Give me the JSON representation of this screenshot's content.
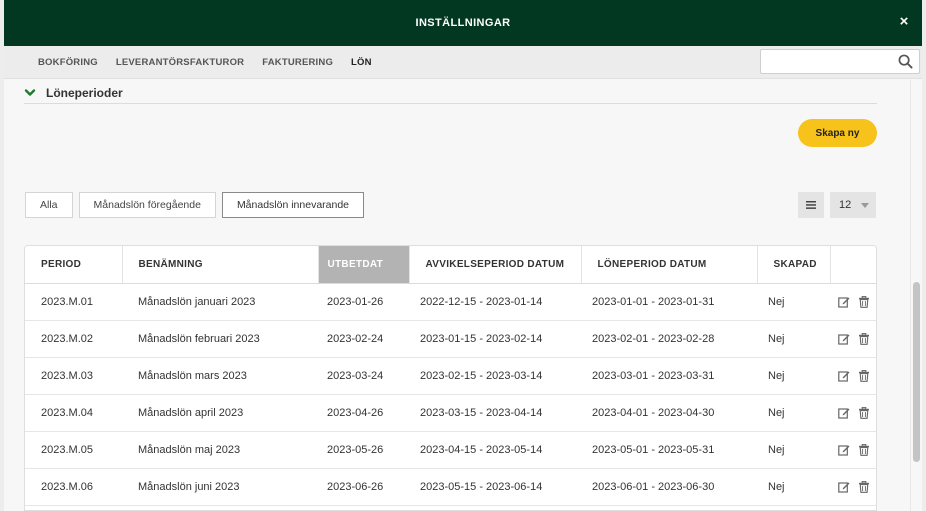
{
  "modal": {
    "title": "INSTÄLLNINGAR",
    "close_label": "×"
  },
  "tabs": [
    {
      "label": "BOKFÖRING"
    },
    {
      "label": "LEVERANTÖRSFAKTUROR"
    },
    {
      "label": "FAKTURERING"
    },
    {
      "label": "LÖN",
      "active": true
    }
  ],
  "search": {
    "value": "",
    "placeholder": ""
  },
  "section": {
    "title": "Löneperioder"
  },
  "create_button": {
    "label": "Skapa ny"
  },
  "filters": [
    {
      "label": "Alla"
    },
    {
      "label": "Månadslön föregående"
    },
    {
      "label": "Månadslön innevarande",
      "active": true
    }
  ],
  "per_page": {
    "value": "12"
  },
  "table": {
    "columns": [
      "PERIOD",
      "BENÄMNING",
      "UTBETDAT",
      "AVVIKELSEPERIOD DATUM",
      "LÖNEPERIOD DATUM",
      "SKAPAD",
      ""
    ],
    "sorted_column": "UTBETDAT",
    "rows": [
      {
        "period": "2023.M.01",
        "name": "Månadslön januari 2023",
        "paid": "2023-01-26",
        "deviation": "2022-12-15 - 2023-01-14",
        "payperiod": "2023-01-01 - 2023-01-31",
        "created": "Nej"
      },
      {
        "period": "2023.M.02",
        "name": "Månadslön februari 2023",
        "paid": "2023-02-24",
        "deviation": "2023-01-15 - 2023-02-14",
        "payperiod": "2023-02-01 - 2023-02-28",
        "created": "Nej"
      },
      {
        "period": "2023.M.03",
        "name": "Månadslön mars 2023",
        "paid": "2023-03-24",
        "deviation": "2023-02-15 - 2023-03-14",
        "payperiod": "2023-03-01 - 2023-03-31",
        "created": "Nej"
      },
      {
        "period": "2023.M.04",
        "name": "Månadslön april 2023",
        "paid": "2023-04-26",
        "deviation": "2023-03-15 - 2023-04-14",
        "payperiod": "2023-04-01 - 2023-04-30",
        "created": "Nej"
      },
      {
        "period": "2023.M.05",
        "name": "Månadslön maj 2023",
        "paid": "2023-05-26",
        "deviation": "2023-04-15 - 2023-05-14",
        "payperiod": "2023-05-01 - 2023-05-31",
        "created": "Nej"
      },
      {
        "period": "2023.M.06",
        "name": "Månadslön juni 2023",
        "paid": "2023-06-26",
        "deviation": "2023-05-15 - 2023-06-14",
        "payperiod": "2023-06-01 - 2023-06-30",
        "created": "Nej"
      }
    ]
  },
  "icons": {
    "search": "search-icon",
    "chevron": "chevron-down-icon",
    "list": "list-icon",
    "edit": "edit-icon",
    "delete": "trash-icon"
  },
  "colors": {
    "header_bg": "#023822",
    "accent_button": "#f7c31a",
    "chevron": "#1f7a2e",
    "sorted_header": "#b3b3b3"
  }
}
